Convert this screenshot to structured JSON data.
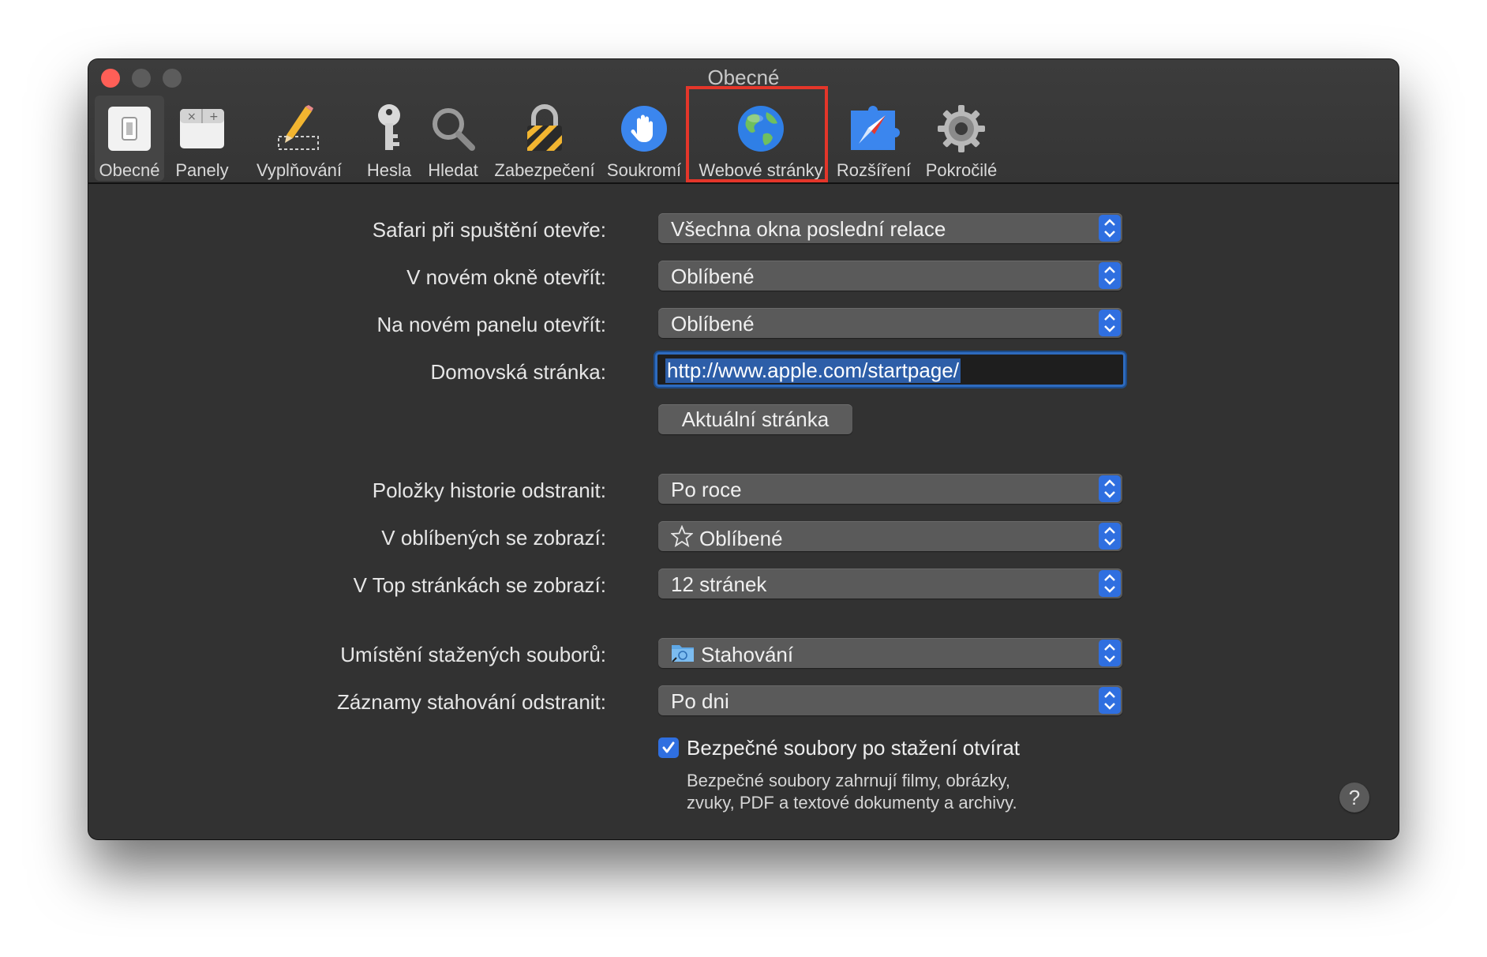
{
  "window": {
    "title": "Obecné"
  },
  "toolbar": {
    "items": [
      {
        "label": "Obecné",
        "icon": "switch-icon",
        "selected": true
      },
      {
        "label": "Panely",
        "icon": "tabs-icon"
      },
      {
        "label": "Vyplňování",
        "icon": "pencil-icon"
      },
      {
        "label": "Hesla",
        "icon": "key-icon"
      },
      {
        "label": "Hledat",
        "icon": "magnifier-icon"
      },
      {
        "label": "Zabezpečení",
        "icon": "padlock-icon"
      },
      {
        "label": "Soukromí",
        "icon": "hand-icon"
      },
      {
        "label": "Webové stránky",
        "icon": "globe-icon",
        "highlighted": true
      },
      {
        "label": "Rozšíření",
        "icon": "puzzle-compass-icon"
      },
      {
        "label": "Pokročilé",
        "icon": "gear-icon"
      }
    ]
  },
  "settings": {
    "launch": {
      "label": "Safari při spuštění otevře:",
      "value": "Všechna okna poslední relace"
    },
    "new_window": {
      "label": "V novém okně otevřít:",
      "value": "Oblíbené"
    },
    "new_tab": {
      "label": "Na novém panelu otevřít:",
      "value": "Oblíbené"
    },
    "homepage": {
      "label": "Domovská stránka:",
      "value": "http://www.apple.com/startpage/"
    },
    "current_page_button": "Aktuální stránka",
    "history": {
      "label": "Položky historie odstranit:",
      "value": "Po roce"
    },
    "favorites": {
      "label": "V oblíbených se zobrazí:",
      "value": "Oblíbené"
    },
    "top_sites": {
      "label": "V Top stránkách se zobrazí:",
      "value": "12 stránek"
    },
    "download_location": {
      "label": "Umístění stažených souborů:",
      "value": "Stahování"
    },
    "download_removal": {
      "label": "Záznamy stahování odstranit:",
      "value": "Po dni"
    },
    "open_safe_files": {
      "checked": true,
      "label": "Bezpečné soubory po stažení otvírat",
      "note_line1": "Bezpečné soubory zahrnují filmy, obrázky,",
      "note_line2": "zvuky, PDF a textové dokumenty a archivy."
    }
  },
  "help_button": "?",
  "colors": {
    "accent": "#2f6fe0",
    "highlight_box": "#e4362a",
    "window_bg": "#323232"
  }
}
